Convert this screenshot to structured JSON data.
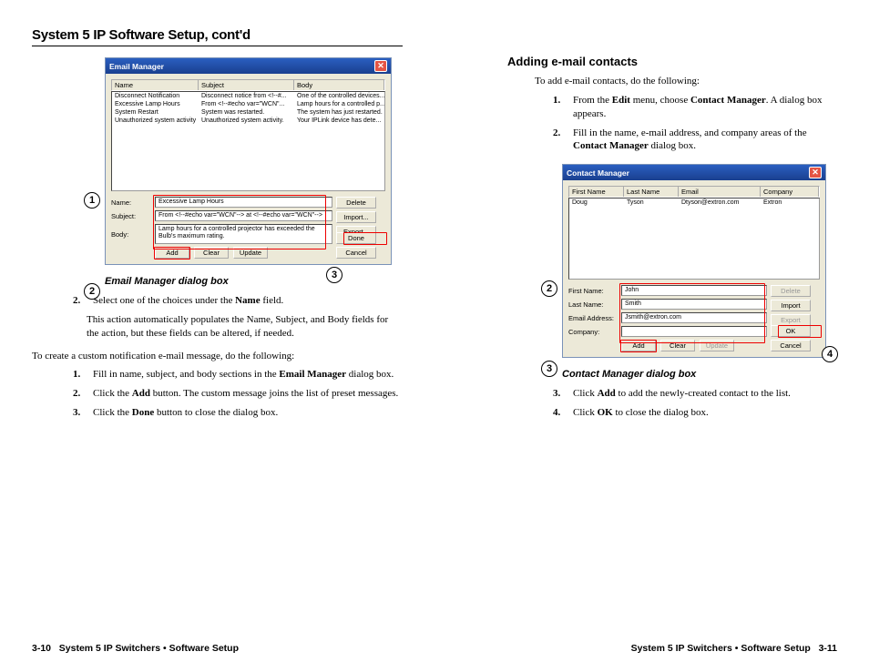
{
  "left": {
    "title": "System 5 IP Software Setup, cont'd",
    "dialog": {
      "title": "Email Manager",
      "columns": {
        "c1": "Name",
        "c2": "Subject",
        "c3": "Body"
      },
      "rows": [
        {
          "c1": "Disconnect Notification",
          "c2": "Disconnect notice from <!--#...",
          "c3": "One of the controlled devices..."
        },
        {
          "c1": "Excessive Lamp Hours",
          "c2": "From <!--#echo var=\"WCN\"...",
          "c3": "Lamp hours for a controlled p..."
        },
        {
          "c1": "System Restart",
          "c2": "System was restarted.",
          "c3": "The system has just restarted."
        },
        {
          "c1": "Unauthorized system activity",
          "c2": "Unauthorized system activity.",
          "c3": "Your IPLink device has dete..."
        }
      ],
      "form": {
        "name_label": "Name:",
        "name_value": "Excessive Lamp Hours",
        "subject_label": "Subject:",
        "subject_value": "From <!--#echo var=\"WCN\"--> at <!--#echo var=\"WCN\"-->",
        "body_label": "Body:",
        "body_value": "Lamp hours for a controlled projector has exceeded the Bulb's maximum rating."
      },
      "buttons": {
        "delete": "Delete",
        "import": "Import...",
        "export": "Export...",
        "add": "Add",
        "clear": "Clear",
        "update": "Update",
        "done": "Done",
        "cancel": "Cancel"
      }
    },
    "caption": "Email Manager dialog box",
    "step2": {
      "num": "2.",
      "line1": "Select one of the choices under the Name field.",
      "line2": "This action automatically populates the Name, Subject, and Body fields for the action, but these fields can be altered, if needed."
    },
    "custom_intro": "To create a custom notification e-mail message, do the following:",
    "custom_steps": [
      {
        "num": "1.",
        "txt": "Fill in name, subject, and body sections in the Email Manager dialog box."
      },
      {
        "num": "2.",
        "txt": "Click the Add button.  The custom message joins the list of preset messages."
      },
      {
        "num": "3.",
        "txt": "Click the Done button to close the dialog box."
      }
    ],
    "footer_page": "3-10",
    "footer_text": "System 5 IP Switchers • Software Setup"
  },
  "right": {
    "section": "Adding e-mail contacts",
    "intro": "To add e-mail contacts, do the following:",
    "steps_top": [
      {
        "num": "1.",
        "txt": "From the Edit menu, choose Contact Manager.  A dialog box appears."
      },
      {
        "num": "2.",
        "txt": "Fill in the name, e-mail address, and company areas of the Contact Manager dialog box."
      }
    ],
    "dialog": {
      "title": "Contact Manager",
      "columns": {
        "c1": "First Name",
        "c2": "Last Name",
        "c3": "Email",
        "c4": "Company"
      },
      "rows": [
        {
          "c1": "Doug",
          "c2": "Tyson",
          "c3": "Dtyson@extron.com",
          "c4": "Extron"
        }
      ],
      "form": {
        "fn_label": "First Name:",
        "fn_value": "John",
        "ln_label": "Last Name:",
        "ln_value": "Smith",
        "em_label": "Email Address:",
        "em_value": "Jsmith@extron.com",
        "co_label": "Company:",
        "co_value": ""
      },
      "buttons": {
        "delete": "Delete",
        "import": "Import",
        "export": "Export",
        "add": "Add",
        "clear": "Clear",
        "update": "Update",
        "ok": "OK",
        "cancel": "Cancel"
      }
    },
    "caption": "Contact Manager dialog box",
    "steps_bottom": [
      {
        "num": "3.",
        "txt": "Click Add to add the newly-created contact to the list."
      },
      {
        "num": "4.",
        "txt": "Click OK to close the dialog box."
      }
    ],
    "footer_text": "System 5 IP Switchers • Software Setup",
    "footer_page": "3-11"
  }
}
